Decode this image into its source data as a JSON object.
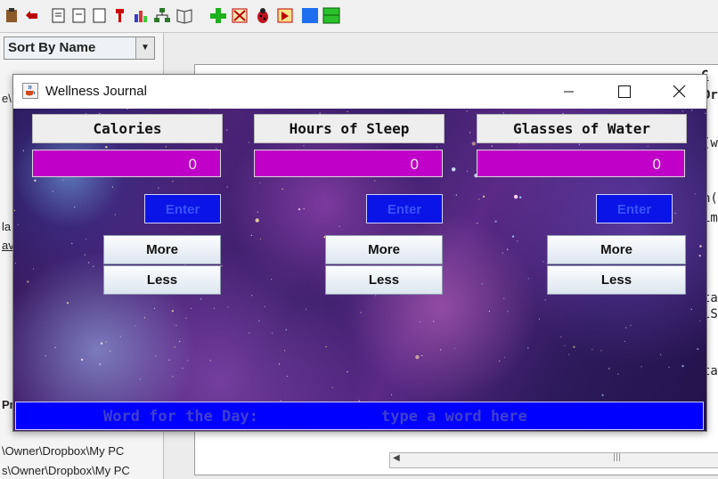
{
  "ide": {
    "sort_label": "Sort By Name",
    "left_lines": [
      "e\\",
      "la",
      "av",
      "Pr",
      "\\Owner\\Dropbox\\My PC",
      "s\\Owner\\Dropbox\\My PC"
    ],
    "code_fragments": [
      "(w",
      "n(",
      "im",
      "ta",
      "lS",
      "ta",
      "Dr",
      "C"
    ]
  },
  "app": {
    "title": "Wellness Journal",
    "columns": [
      {
        "header": "Calories",
        "value": "0",
        "enter_label": "Enter",
        "more_label": "More",
        "less_label": "Less"
      },
      {
        "header": "Hours of Sleep",
        "value": "0",
        "enter_label": "Enter",
        "more_label": "More",
        "less_label": "Less"
      },
      {
        "header": "Glasses of Water",
        "value": "0",
        "enter_label": "Enter",
        "more_label": "More",
        "less_label": "Less"
      }
    ],
    "word_label": "Word for the Day:",
    "word_placeholder": "type a word here",
    "colors": {
      "field_bg": "#c000c8",
      "enter_bg": "#0a14e6",
      "word_bar_bg": "#0000ff"
    }
  }
}
